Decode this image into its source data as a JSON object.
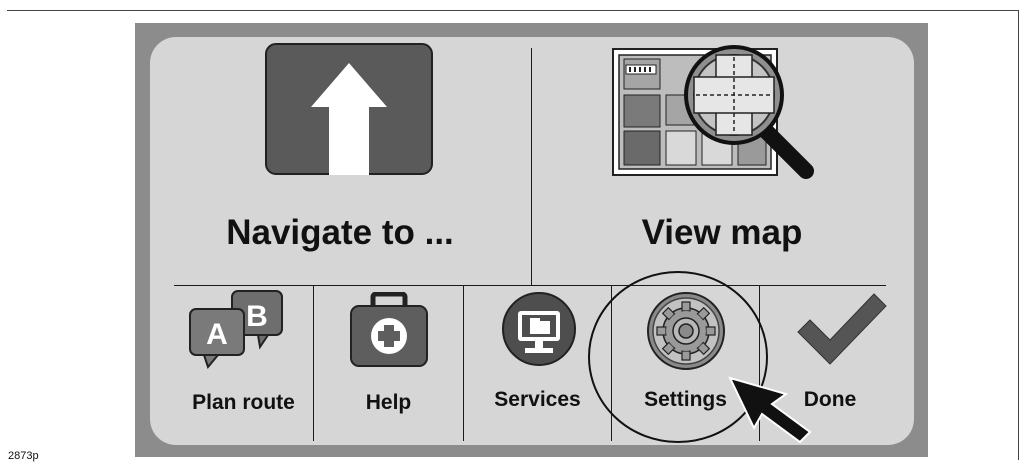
{
  "main_menu": {
    "navigate_label": "Navigate to ...",
    "view_map_label": "View map"
  },
  "bottom_bar": {
    "plan_route_label": "Plan route",
    "plan_route_icon_letters": [
      "A",
      "B"
    ],
    "help_label": "Help",
    "services_label": "Services",
    "settings_label": "Settings",
    "done_label": "Done"
  },
  "figure": {
    "reference": "2873p"
  },
  "icons": {
    "navigate": "up-arrow-icon",
    "view_map": "map-magnifier-icon",
    "plan_route": "ab-speech-bubbles-icon",
    "help": "first-aid-kit-icon",
    "services": "monitor-icon",
    "settings": "gear-icon",
    "done": "checkmark-icon",
    "pointer": "pointer-arrow-icon"
  },
  "colors": {
    "screen_bg": "#d6d6d6",
    "bezel": "#8c8c8c",
    "tile_dark": "#5a5a5a",
    "checkmark": "#555555"
  }
}
